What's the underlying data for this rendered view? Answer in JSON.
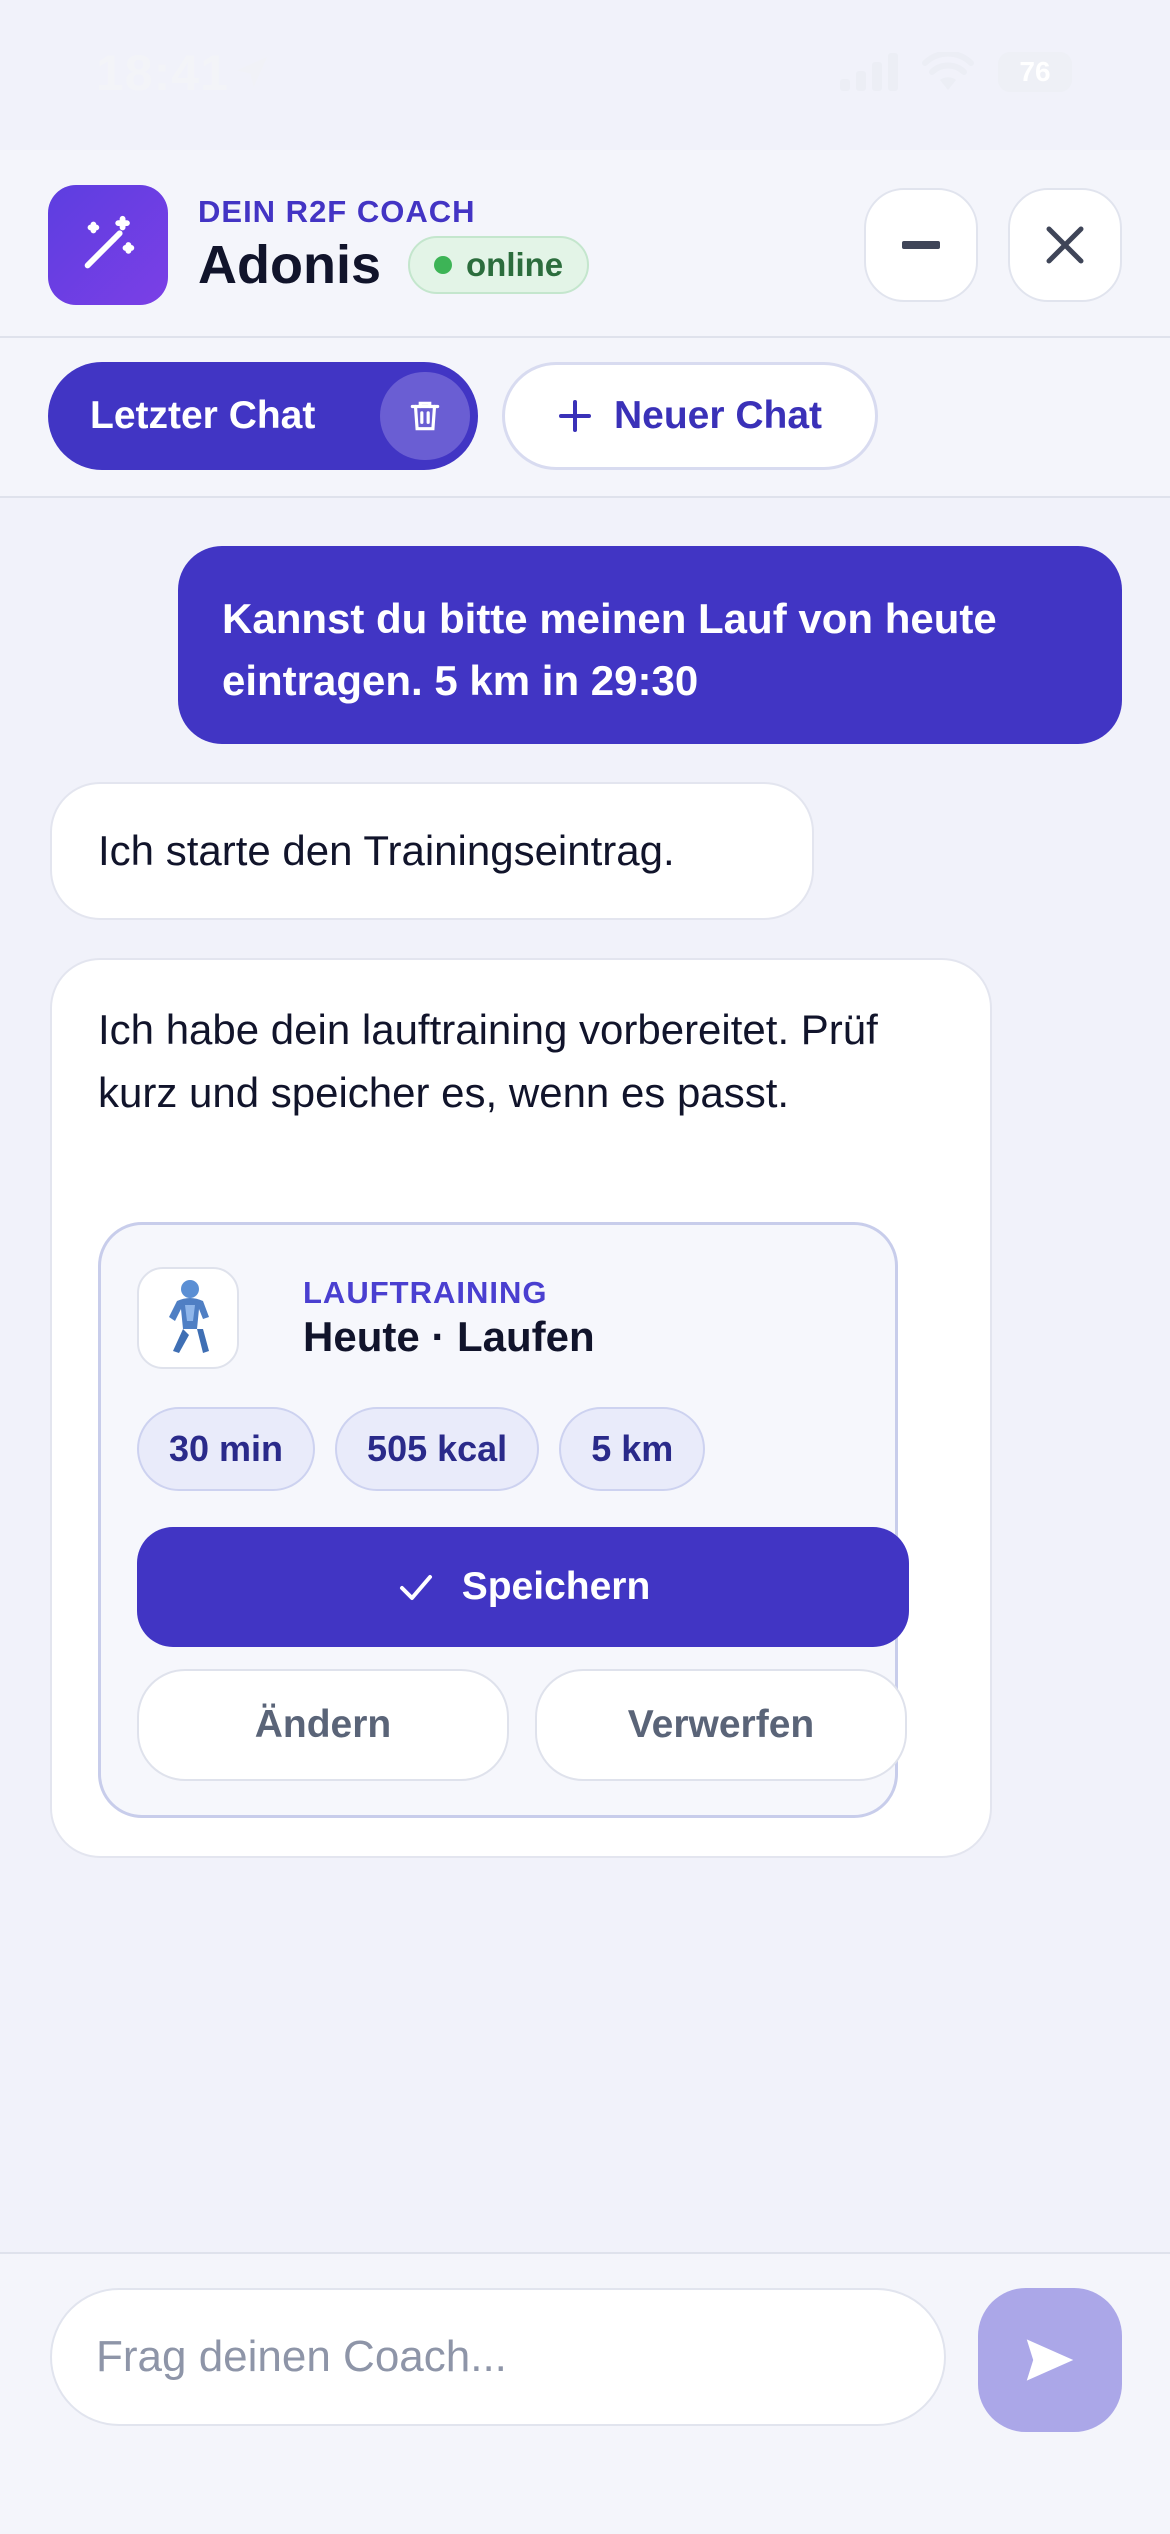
{
  "status_bar": {
    "time": "18:41",
    "battery": "76"
  },
  "header": {
    "kicker": "DEIN R2F COACH",
    "name": "Adonis",
    "status": "online"
  },
  "tabs": {
    "active_label": "Letzter Chat",
    "new_label": "Neuer Chat"
  },
  "messages": {
    "user_1": "Kannst du bitte meinen Lauf von heute eintragen. 5 km in 29:30",
    "bot_1": "Ich starte den Trainingseintrag.",
    "bot_2": "Ich habe dein lauftraining vorbereitet. Prüf kurz und speicher es, wenn es passt."
  },
  "workout_card": {
    "kicker": "LAUFTRAINING",
    "title": "Heute · Laufen",
    "chips": [
      "30 min",
      "505 kcal",
      "5 km"
    ],
    "save_label": "Speichern",
    "edit_label": "Ändern",
    "discard_label": "Verwerfen"
  },
  "composer": {
    "placeholder": "Frag deinen Coach...",
    "value": ""
  },
  "colors": {
    "accent": "#4135c4",
    "online": "#3db456",
    "send_disabled": "#aba7e8"
  },
  "icons": {
    "avatar": "magic-wand-icon",
    "minimize": "minus-icon",
    "close": "close-icon",
    "delete": "trash-icon",
    "new": "plus-icon",
    "save": "check-icon",
    "send": "send-icon"
  }
}
